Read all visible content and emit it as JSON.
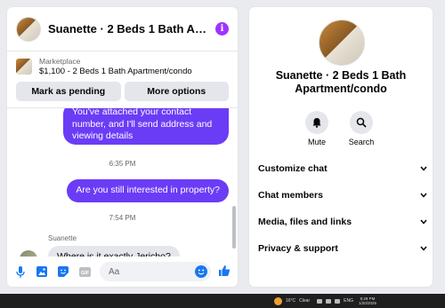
{
  "chat": {
    "title": "Suanette · 2 Beds 1 Bath Apart…",
    "info_icon": "i",
    "marketplace_label": "Marketplace",
    "listing": "$1,100 - 2 Beds 1 Bath Apartment/condo",
    "mark_pending": "Mark as pending",
    "more_options": "More options",
    "messages": {
      "outgoing_1": "You've attached your contact number, and I'll send address and viewing details",
      "time_1": "6:35 PM",
      "outgoing_2": "Are you still interested in property?",
      "time_2": "7:54 PM",
      "sender_name": "Suanette",
      "incoming_1": "Where is it exactly Jericho?"
    },
    "composer_placeholder": "Aa"
  },
  "info": {
    "title": "Suanette · 2 Beds 1 Bath Apartment/condo",
    "mute_label": "Mute",
    "search_label": "Search",
    "sections": [
      "Customize chat",
      "Chat members",
      "Media, files and links",
      "Privacy & support"
    ]
  },
  "taskbar": {
    "weather": "16°C",
    "weather_desc": "Clear",
    "lang": "ENG",
    "time": "8:29 PM",
    "date": "1/20/2026"
  },
  "colors": {
    "accent": "#6b3cf6",
    "info_icon": "#a033ff",
    "link_blue": "#1877f2"
  }
}
